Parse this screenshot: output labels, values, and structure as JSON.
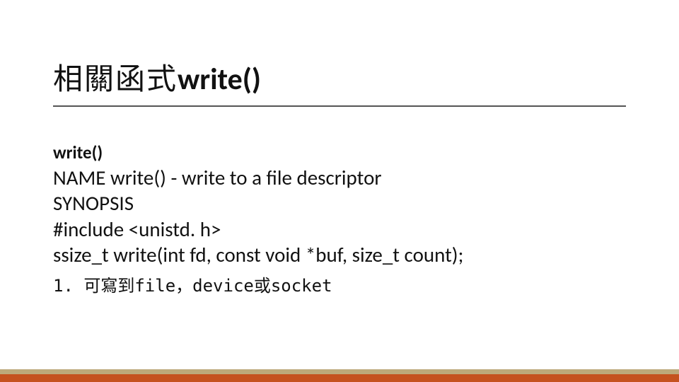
{
  "title": {
    "prefix": "相關函式",
    "fn": "write()"
  },
  "body": {
    "fn_head": "write()",
    "lines": [
      "NAME write() - write to a file descriptor",
      "SYNOPSIS",
      "#include <unistd. h>",
      "ssize_t write(int fd, const void *buf, size_t count);"
    ],
    "note": "1. 可寫到file，device或socket"
  },
  "colors": {
    "accent": "#c5521f",
    "bar_top": "#bda97a"
  }
}
